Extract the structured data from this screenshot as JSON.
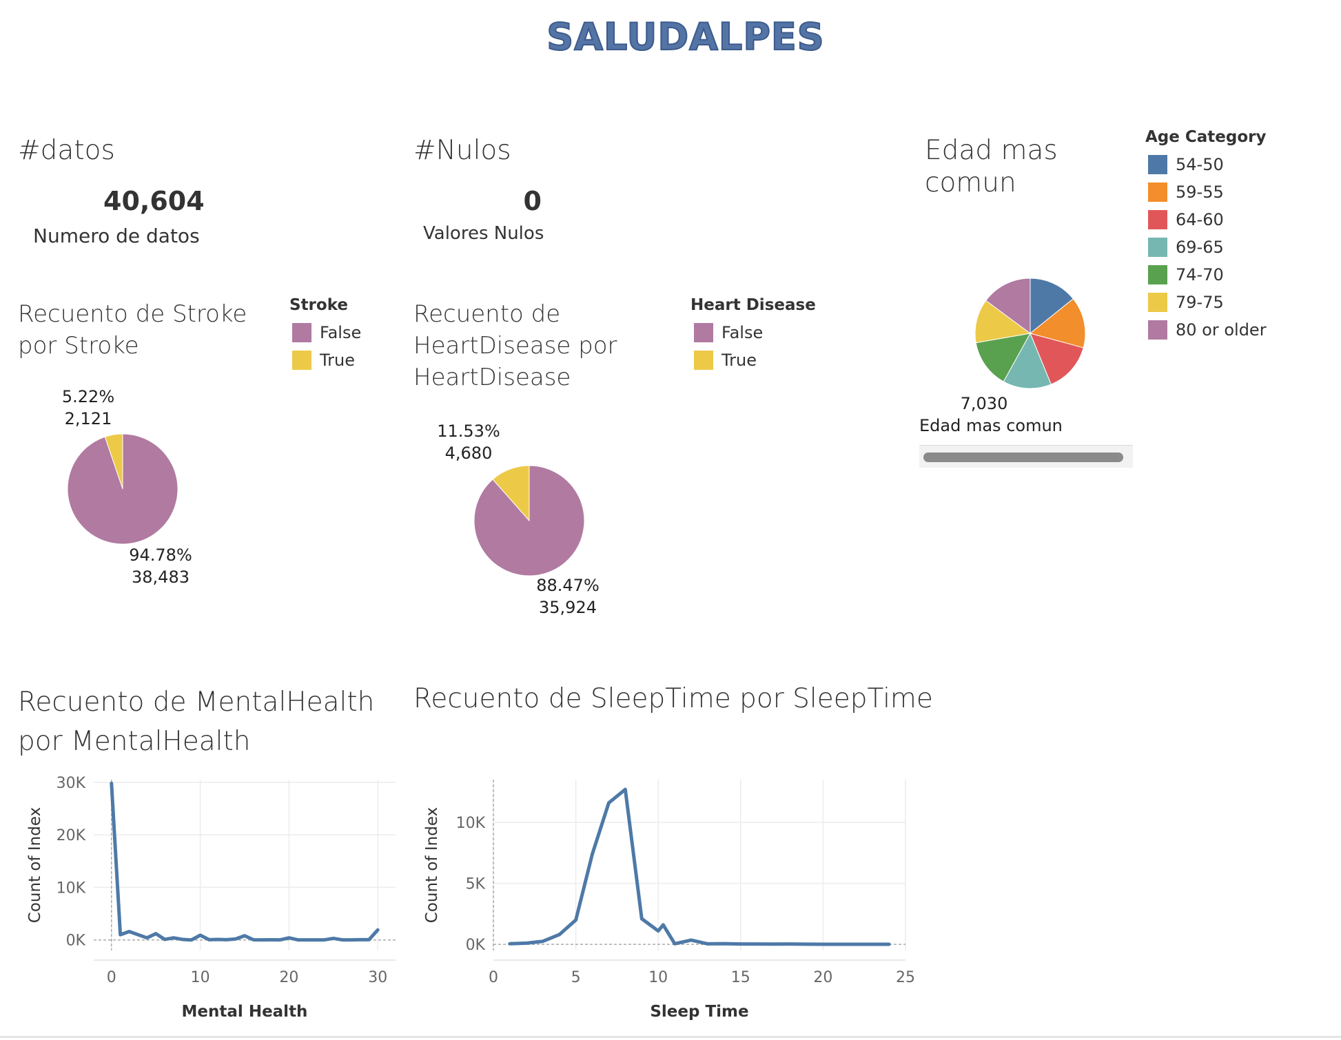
{
  "dashboard_title": "SALUDALPES",
  "kpi_datos": {
    "title": "#datos",
    "value": "40,604",
    "label": "Numero de datos"
  },
  "kpi_nulos": {
    "title": "#Nulos",
    "value": "0",
    "label": "Valores Nulos"
  },
  "edad": {
    "title_line1": "Edad mas",
    "title_line2": "comun",
    "value": "7,030",
    "label": "Edad mas comun"
  },
  "stroke": {
    "title_line1": "Recuento de Stroke",
    "title_line2": "por Stroke",
    "legend_title": "Stroke",
    "legend": [
      {
        "label": "False",
        "color": "#b07aa1"
      },
      {
        "label": "True",
        "color": "#edc948"
      }
    ],
    "true_pct": "5.22%",
    "true_count": "2,121",
    "false_pct": "94.78%",
    "false_count": "38,483"
  },
  "heart": {
    "title_line1": "Recuento de",
    "title_line2": "HeartDisease por",
    "title_line3": "HeartDisease",
    "legend_title": "Heart Disease",
    "legend": [
      {
        "label": "False",
        "color": "#b07aa1"
      },
      {
        "label": "True",
        "color": "#edc948"
      }
    ],
    "true_pct": "11.53%",
    "true_count": "4,680",
    "false_pct": "88.47%",
    "false_count": "35,924"
  },
  "age_legend": {
    "title": "Age Category",
    "items": [
      {
        "label": "54-50",
        "color": "#4e79a7"
      },
      {
        "label": "59-55",
        "color": "#f28e2b"
      },
      {
        "label": "64-60",
        "color": "#e15759"
      },
      {
        "label": "69-65",
        "color": "#76b7b2"
      },
      {
        "label": "74-70",
        "color": "#59a14f"
      },
      {
        "label": "79-75",
        "color": "#edc948"
      },
      {
        "label": "80 or older",
        "color": "#b07aa1"
      }
    ]
  },
  "mental": {
    "title_line1": "Recuento de MentalHealth",
    "title_line2": "por MentalHealth"
  },
  "sleep": {
    "title": "Recuento de SleepTime por SleepTime"
  },
  "chart_data": [
    {
      "type": "pie",
      "title": "Recuento de Stroke por Stroke",
      "categories": [
        "False",
        "True"
      ],
      "values": [
        38483,
        2121
      ],
      "percent": [
        94.78,
        5.22
      ],
      "colors": [
        "#b07aa1",
        "#edc948"
      ]
    },
    {
      "type": "pie",
      "title": "Recuento de HeartDisease por HeartDisease",
      "categories": [
        "False",
        "True"
      ],
      "values": [
        35924,
        4680
      ],
      "percent": [
        88.47,
        11.53
      ],
      "colors": [
        "#b07aa1",
        "#edc948"
      ]
    },
    {
      "type": "pie",
      "title": "Edad mas comun",
      "categories": [
        "54-50",
        "59-55",
        "64-60",
        "69-65",
        "74-70",
        "79-75",
        "80 or older"
      ],
      "values": [
        5770,
        6090,
        5930,
        5770,
        5780,
        5230,
        6030
      ],
      "colors": [
        "#4e79a7",
        "#f28e2b",
        "#e15759",
        "#76b7b2",
        "#59a14f",
        "#edc948",
        "#b07aa1"
      ]
    },
    {
      "type": "line",
      "title": "Recuento de MentalHealth por MentalHealth",
      "xlabel": "Mental Health",
      "ylabel": "Count of Index",
      "xlim": [
        -2,
        32
      ],
      "ylim": [
        -2000,
        30500
      ],
      "xticks": [
        0,
        10,
        20,
        30
      ],
      "yticks": [
        0,
        10000,
        20000,
        30000
      ],
      "ytick_labels": [
        "0K",
        "10K",
        "20K",
        "30K"
      ],
      "grid": true,
      "color": "#4e79a7",
      "x": [
        0,
        1,
        2,
        3,
        4,
        5,
        6,
        7,
        8,
        9,
        10,
        11,
        12,
        13,
        14,
        15,
        16,
        17,
        18,
        19,
        20,
        21,
        22,
        23,
        24,
        25,
        26,
        27,
        28,
        29,
        30
      ],
      "y": [
        29800,
        1000,
        1600,
        1000,
        400,
        1200,
        100,
        400,
        100,
        0,
        900,
        50,
        100,
        50,
        200,
        800,
        30,
        20,
        30,
        20,
        400,
        20,
        20,
        20,
        20,
        300,
        20,
        20,
        50,
        40,
        1900
      ]
    },
    {
      "type": "line",
      "title": "Recuento de SleepTime por SleepTime",
      "xlabel": "Sleep Time",
      "ylabel": "Count of Index",
      "xlim": [
        0,
        25
      ],
      "ylim": [
        -500,
        13500
      ],
      "xticks": [
        0,
        5,
        10,
        15,
        20,
        25
      ],
      "yticks": [
        0,
        5000,
        10000
      ],
      "ytick_labels": [
        "0K",
        "5K",
        "10K"
      ],
      "grid": true,
      "color": "#4e79a7",
      "x": [
        1,
        2,
        3,
        4,
        5,
        6,
        7,
        8,
        9,
        10,
        10.3,
        11,
        12,
        13,
        14,
        15,
        16,
        17,
        18,
        19,
        20,
        22,
        24
      ],
      "y": [
        50,
        100,
        250,
        800,
        2000,
        7400,
        11600,
        12700,
        2100,
        1100,
        1600,
        50,
        350,
        40,
        60,
        30,
        30,
        20,
        30,
        15,
        10,
        5,
        5
      ]
    }
  ]
}
